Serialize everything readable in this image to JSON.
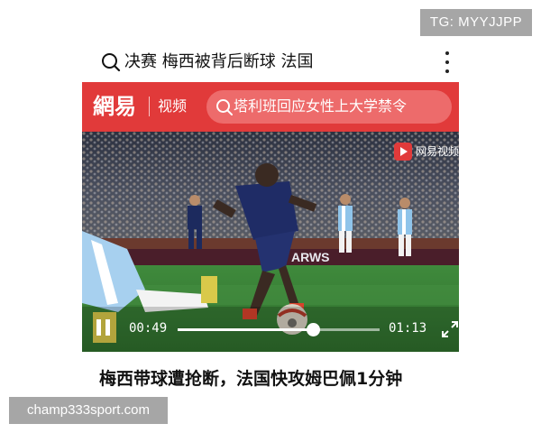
{
  "badge": {
    "text": "TG: MYYJJPP"
  },
  "search": {
    "query": "决赛 梅西被背后断球 法国",
    "icon": "search-icon"
  },
  "menu": {
    "icon": "more-vertical-icon"
  },
  "app_bar": {
    "logo": "網易",
    "channel": "视频",
    "search_text": "塔利班回应女性上大学禁令",
    "accent_color": "#e13a3a"
  },
  "video": {
    "watermark": "网易视频",
    "current_time": "00:49",
    "total_time": "01:13",
    "progress": 0.67,
    "pitch_board_text": "ARWS",
    "player_state": "playing"
  },
  "headline": "梅西带球遭抢断，法国快攻姆巴佩1分钟",
  "footer": {
    "text": "champ333sport.com"
  }
}
